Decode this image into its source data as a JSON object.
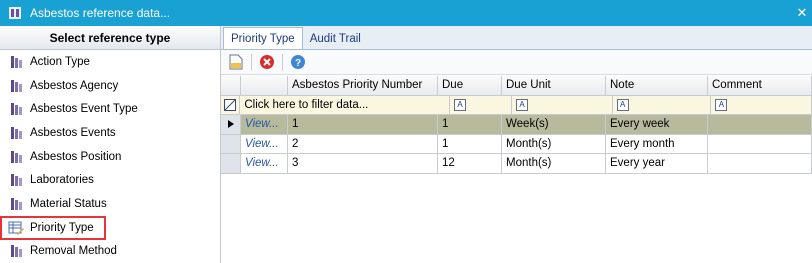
{
  "window": {
    "title": "Asbestos reference data...",
    "close_glyph": "✕"
  },
  "left_panel": {
    "header": "Select reference type",
    "items": [
      {
        "label": "Action Type",
        "icon": "table-icon"
      },
      {
        "label": "Asbestos Agency",
        "icon": "table-icon"
      },
      {
        "label": "Asbestos Event Type",
        "icon": "table-icon"
      },
      {
        "label": "Asbestos Events",
        "icon": "table-icon"
      },
      {
        "label": "Asbestos Position",
        "icon": "table-icon"
      },
      {
        "label": "Laboratories",
        "icon": "table-icon"
      },
      {
        "label": "Material Status",
        "icon": "table-icon"
      },
      {
        "label": "Priority Type",
        "icon": "edit-table-icon",
        "selected": true
      },
      {
        "label": "Removal Method",
        "icon": "table-icon"
      }
    ]
  },
  "tabs": [
    {
      "label": "Priority Type",
      "active": true
    },
    {
      "label": "Audit Trail",
      "active": false
    }
  ],
  "toolbar": {
    "buttons": [
      {
        "name": "new-record-icon"
      },
      {
        "name": "delete-icon"
      },
      {
        "name": "help-icon"
      }
    ]
  },
  "grid": {
    "columns": [
      "Asbestos Priority Number",
      "Due",
      "Due Unit",
      "Note",
      "Comment"
    ],
    "filter_placeholder": "Click here to filter data...",
    "filter_glyph": "A",
    "rows": [
      {
        "view": "View...",
        "priority": "1",
        "due": "1",
        "due_unit": "Week(s)",
        "note": "Every week",
        "comment": "",
        "selected": true
      },
      {
        "view": "View...",
        "priority": "2",
        "due": "1",
        "due_unit": "Month(s)",
        "note": "Every month",
        "comment": ""
      },
      {
        "view": "View...",
        "priority": "3",
        "due": "12",
        "due_unit": "Month(s)",
        "note": "Every year",
        "comment": ""
      }
    ]
  },
  "colors": {
    "titlebar": "#1aa1d4",
    "selected_row": "#b8ba9d",
    "selection_outline": "#e8333a",
    "filter_row": "#fbf6e0"
  }
}
